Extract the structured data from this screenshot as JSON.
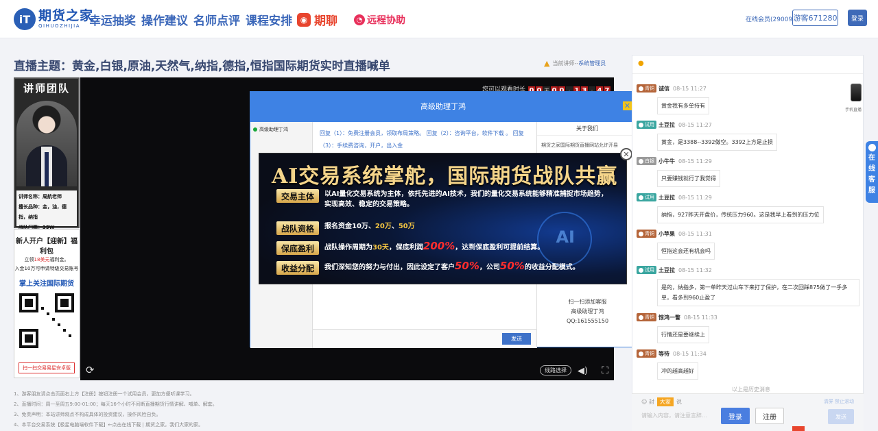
{
  "header": {
    "logo_badge": "iT",
    "logo_main": "期货之家",
    "logo_sub": "QIHUOZHIJIA",
    "nav": [
      "幸运抽奖",
      "操作建议",
      "名师点评",
      "课程安排"
    ],
    "qiliao": "期聊",
    "remote": "远程协助",
    "online": "在线会员(29009)",
    "visitor": "游客671280",
    "login": "登录"
  },
  "topic": "直播主题：黄金,白银,原油,天然气,纳指,德指,恒指国际期货实时直播喊单",
  "lecturer": {
    "label": "当前讲师--",
    "name": "系统管理员"
  },
  "teacher_panel": {
    "title": "讲师团队",
    "lines": [
      "讲师名称：周航老师",
      "擅长品种：金，油，德指，纳指",
      "战队门槛：35W"
    ]
  },
  "promo_panel": {
    "title": "新人开户【迎新】福利包",
    "line1_pre": "立领",
    "line1_red": "18美元",
    "line1_post": "福利金。",
    "line2": "入金10万可申请特级交易账号",
    "follow": "掌上关注国际期货",
    "button": "扫一扫交易易星安卓版"
  },
  "video": {
    "watch_label": "您可以观看时长",
    "digits": [
      "0",
      "0",
      "天",
      "0",
      "0",
      ":",
      "1",
      "3",
      ":",
      "4",
      "7"
    ],
    "line_select": "线路选择"
  },
  "chat_window": {
    "title": "高级助理丁鸿",
    "contact": "高级助理丁鸿",
    "message": "回复（1）：免费注册会员，领取布局策略。 回复（2）：咨询平台，软件下载 。 回复（3）：手续费咨询，开户，出入金",
    "send": "发送",
    "about": "关于我们",
    "about_text": "期货之家国际期货直播网站允许开易",
    "scan1": "扫一扫添加客服",
    "scan2": "高级助理丁鸿",
    "scan3": "QQ:161555150"
  },
  "banner": {
    "title": "AI交易系统掌舵，国际期货战队共赢",
    "rows": [
      {
        "tag": "交易主体",
        "parts": [
          {
            "t": "以AI量化交易系统为主体，依托先进的AI技术，我们的量化交易系统能够精准捕捉市场趋势，实现高效、稳定的交易策略。",
            "c": ""
          }
        ]
      },
      {
        "tag": "战队资格",
        "parts": [
          {
            "t": "报名资金10万、",
            "c": ""
          },
          {
            "t": "20万",
            "c": "hl"
          },
          {
            "t": "、",
            "c": ""
          },
          {
            "t": "50万",
            "c": "hl"
          }
        ]
      },
      {
        "tag": "保底盈利",
        "parts": [
          {
            "t": "战队操作周期为",
            "c": ""
          },
          {
            "t": "30天",
            "c": "hl"
          },
          {
            "t": "，保底利润",
            "c": ""
          },
          {
            "t": "200%",
            "c": "hl2"
          },
          {
            "t": "，达到保底盈利可提前结算。",
            "c": ""
          }
        ]
      },
      {
        "tag": "收益分配",
        "parts": [
          {
            "t": "我们深知您的努力与付出，因此设定了客户",
            "c": ""
          },
          {
            "t": "50%",
            "c": "hl2"
          },
          {
            "t": "，公司",
            "c": ""
          },
          {
            "t": "50%",
            "c": "hl2"
          },
          {
            "t": "的收益分配模式。",
            "c": ""
          }
        ]
      }
    ],
    "ai_text": "AI"
  },
  "notes": [
    "1、游客朋友请点击页面右上方【注册】按钮注册一个试用会员，更加方便听课学习。",
    "2、直播时间：周一至周五9:00-01:00；每天16个小时不间断直播期货行情讲解、喊单、解套。",
    "3、免责声明：本站讲师观点不构成具体的投资建议，操作风险自负。",
    "4、本平台交易系统【极星电脑端软件下载】←点击在线下载 | 期货之家。我们大家的家。"
  ],
  "chat": {
    "messages": [
      {
        "role": "青铜",
        "role_class": "bronze",
        "user": "诚信",
        "time": "08-15 11:27",
        "text": "黄金我有多单持有"
      },
      {
        "role": "试用",
        "role_class": "trial",
        "user": "土豆拉",
        "time": "08-15 11:27",
        "text": "黄金，是3388--3392做空。3392上方是止损"
      },
      {
        "role": "白银",
        "role_class": "white",
        "user": "小牛牛",
        "time": "08-15 11:29",
        "text": "只要赚钱就行了我觉得"
      },
      {
        "role": "试用",
        "role_class": "trial",
        "user": "土豆拉",
        "time": "08-15 11:29",
        "text": "纳指，927昨天开盘价，传统压力960。这是我早上看到的压力位"
      },
      {
        "role": "青铜",
        "role_class": "bronze",
        "user": "小苹果",
        "time": "08-15 11:31",
        "text": "恒指这会还有机会吗"
      },
      {
        "role": "试用",
        "role_class": "trial",
        "user": "土豆拉",
        "time": "08-15 11:32",
        "text": "是的，纳指多，第一单昨天过山车下来打了保护，在二次回踩875做了一手多单，看多到960止盈了"
      },
      {
        "role": "青铜",
        "role_class": "bronze",
        "user": "惊鸿一瞥",
        "time": "08-15 11:33",
        "text": "行情还是要继续上"
      },
      {
        "role": "青铜",
        "role_class": "bronze",
        "user": "等待",
        "time": "08-15 11:34",
        "text": "冲的越高越好"
      }
    ],
    "history": "以上是历史消息",
    "phone_label": "手机直播",
    "tools_left": "封",
    "tools_big": "大家",
    "tools_mid": "说",
    "tools_right": "清屏 禁止滚动",
    "input_placeholder": "请输入内容，请注意言辞...",
    "login": "登录",
    "register": "注册",
    "send": "发送",
    "service": [
      "在",
      "线",
      "客",
      "服"
    ]
  }
}
